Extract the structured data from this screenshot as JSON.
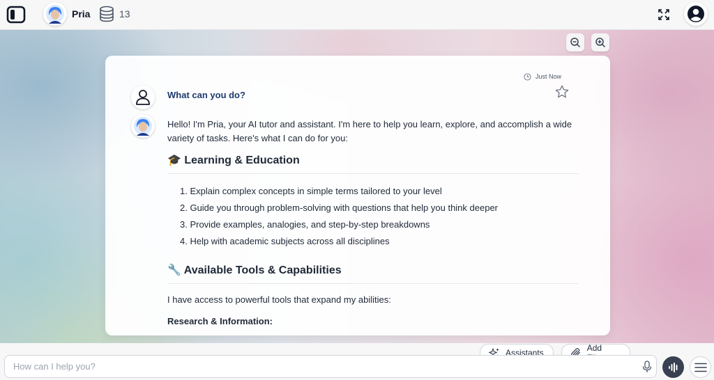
{
  "header": {
    "bot_name": "Pria",
    "count": "13"
  },
  "conversation": {
    "timestamp": "Just Now",
    "user_question": "What can you do?",
    "intro": "Hello! I'm Pria, your AI tutor and assistant. I'm here to help you learn, explore, and accomplish a wide variety of tasks. Here's what I can do for you:",
    "section1": {
      "heading": "🎓 Learning & Education",
      "items": [
        "1. Explain complex concepts in simple terms tailored to your level",
        "2. Guide you through problem-solving with questions that help you think deeper",
        "3. Provide examples, analogies, and step-by-step breakdowns",
        "4. Help with academic subjects across all disciplines"
      ]
    },
    "section2": {
      "heading": "🔧 Available Tools & Capabilities",
      "intro": "I have access to powerful tools that expand my abilities:",
      "subheading": "Research & Information:"
    }
  },
  "composer": {
    "assistants_label": "Assistants",
    "add_files_label": "Add Files",
    "placeholder": "How can I help you?"
  },
  "icons": {
    "sidebar": "sidebar-toggle-icon",
    "database": "database-icon",
    "expand": "expand-icon",
    "user": "user-icon",
    "zoom_out": "zoom-out-icon",
    "zoom_in": "zoom-in-icon",
    "clock": "clock-icon",
    "star": "star-icon",
    "sparkles": "sparkles-icon",
    "paperclip": "paperclip-icon",
    "mic": "microphone-icon",
    "voice": "voice-wave-icon",
    "menu": "hamburger-menu-icon"
  }
}
